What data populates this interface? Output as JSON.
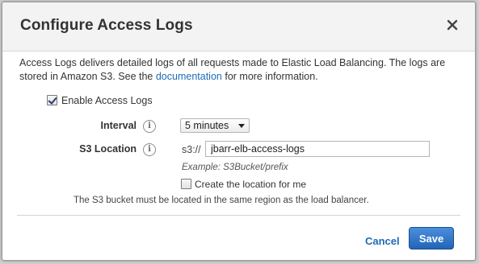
{
  "dialog": {
    "title": "Configure Access Logs",
    "close_icon": "close-icon"
  },
  "description": {
    "text_before": "Access Logs delivers detailed logs of all requests made to Elastic Load Balancing. The logs are stored in Amazon S3. See the ",
    "link_text": "documentation",
    "text_after": " for more information."
  },
  "enable": {
    "label": "Enable Access Logs",
    "checked": true
  },
  "interval": {
    "label": "Interval",
    "info_icon": "info-icon",
    "selected": "5 minutes"
  },
  "s3_location": {
    "label": "S3 Location",
    "info_icon": "info-icon",
    "prefix": "s3://",
    "value": "jbarr-elb-access-logs",
    "example": "Example: S3Bucket/prefix",
    "create_label": "Create the location for me",
    "create_checked": false
  },
  "note": "The S3 bucket must be located in the same region as the load balancer.",
  "footer": {
    "cancel_label": "Cancel",
    "save_label": "Save"
  },
  "colors": {
    "link": "#1f6bb8",
    "primary_button": "#2f72c4",
    "header_bg": "#f3f3f3"
  }
}
